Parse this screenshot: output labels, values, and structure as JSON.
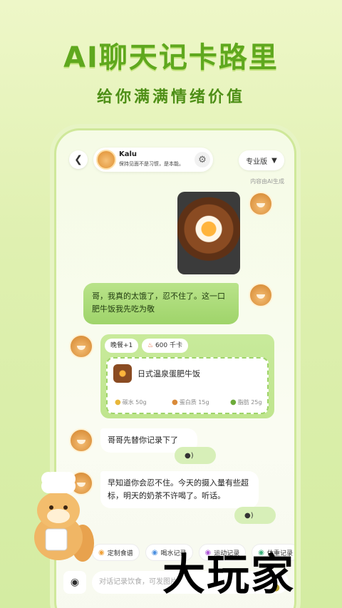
{
  "hero": {
    "title": "AI聊天记卡路里",
    "subtitle": "给你满满情绪价值"
  },
  "header": {
    "bot_name": "Kalu",
    "bot_bio": "保持见面不是习惯，是本能。",
    "plan_label": "专业版",
    "ai_note": "内容由AI生成"
  },
  "chat": {
    "user_text": "哥，我真的太饿了，忍不住了。这一口肥牛饭我先吃为敬",
    "meal_tag": "晚餐+1",
    "kcal": "600 千卡",
    "dish_name": "日式温泉蛋肥牛饭",
    "carb": "碳水 50g",
    "protein": "蛋白质 15g",
    "fat": "脂肪 25g",
    "reply1": "哥哥先替你记录下了",
    "reply2": "早知道你会忍不住。今天的摄入量有些超标，明天的奶茶不许喝了。听话。"
  },
  "quick_actions": [
    {
      "label": "定制食谱",
      "icon": "recipe-icon"
    },
    {
      "label": "喝水记录",
      "icon": "water-icon"
    },
    {
      "label": "运动记录",
      "icon": "exercise-icon"
    },
    {
      "label": "体重记录",
      "icon": "weight-icon"
    }
  ],
  "input": {
    "placeholder": "对话记录饮食，可发图片"
  },
  "watermark": "大玩家",
  "colors": {
    "brand_green": "#5fa81e",
    "bubble_green": "#9fd46a"
  }
}
